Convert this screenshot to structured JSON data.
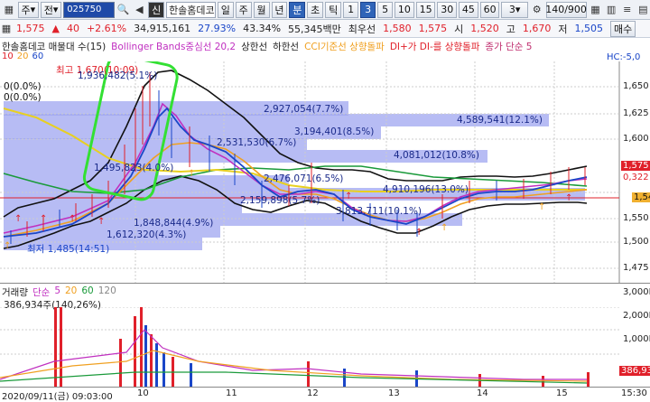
{
  "toolbar": {
    "icon_left": "grid-icon",
    "market": "주",
    "period_type": "전",
    "code": "025750",
    "stock_name": "한솔홈데코",
    "sin": "신",
    "periods": [
      "일",
      "주",
      "월",
      "년",
      "분",
      "초",
      "틱"
    ],
    "active_period": "분",
    "minutes": [
      "1",
      "3",
      "5",
      "10",
      "15",
      "30",
      "45",
      "60"
    ],
    "active_minute": "3",
    "select_value": "3",
    "count": "140/900",
    "right_label": "매수"
  },
  "quote": {
    "price": "1,575",
    "change": "40",
    "change_pct": "+2.61%",
    "volume": "34,915,161",
    "turnover_pct": "27.93%",
    "ratio": "43.34%",
    "amount": "55,345백만",
    "label_max": "최우선",
    "ask": "1,580",
    "bid": "1,575",
    "open_label": "시",
    "open": "1,520",
    "high_label": "고",
    "high": "1,670",
    "low_label": "저",
    "low": "1,505"
  },
  "legend": {
    "items": [
      "한솔홈데코 매물대 수(15)",
      "Bollinger Bands중심선 20,2",
      "상한선",
      "하한선",
      "CCI기준선 상향돌파",
      "DI+가 DI-를 상향돌파",
      "종가 단순 5"
    ],
    "ma_items": [
      "10",
      "20",
      "60"
    ],
    "ma_colors": [
      "#e0202a",
      "#f0a020",
      "#1a46c8"
    ],
    "corner": "HC:-5,0"
  },
  "chart": {
    "zero_labels": [
      "0(0.0%)",
      "0(0.0%)"
    ],
    "high_marker": "최고 1,670(10:09)",
    "low_marker": "최저 1,485(14:51)",
    "vp_labels": [
      "2,927,054(7.7%)",
      "4,589,541(12.1%)",
      "3,194,401(8.5%)",
      "2,531,530(6.7%)",
      "4,081,012(10.8%)",
      "1,936,482(5.1%)",
      "1,495,823(4.0%)",
      "2,476,071(6.5%)",
      "4,910,196(13.0%)",
      "2,159,898(5.7%)",
      "3,813,711(10.1%)",
      "1,848,844(4.9%)",
      "1,612,320(4.3%)"
    ],
    "price_ticks": [
      "1,650",
      "1,625",
      "1,600",
      "1,575",
      "1,550",
      "1,525",
      "1,500",
      "1,475"
    ],
    "current_price_tag": "1,575",
    "sub_tag": "0,322",
    "line_tag": "1,54",
    "time_labels": [
      "10",
      "11",
      "12",
      "13",
      "14",
      "15"
    ],
    "start_time": "2020/09/11(금) 09:03:00",
    "axis_units": "15:30"
  },
  "volume_panel": {
    "title": "거래량",
    "ma_label": "단순",
    "ma_values": [
      "5",
      "20",
      "60",
      "120"
    ],
    "current": "386,934주(140,26%)",
    "ticks": [
      "3,000K",
      "2,000K",
      "1,000K"
    ],
    "last_tag": "386,93"
  }
}
